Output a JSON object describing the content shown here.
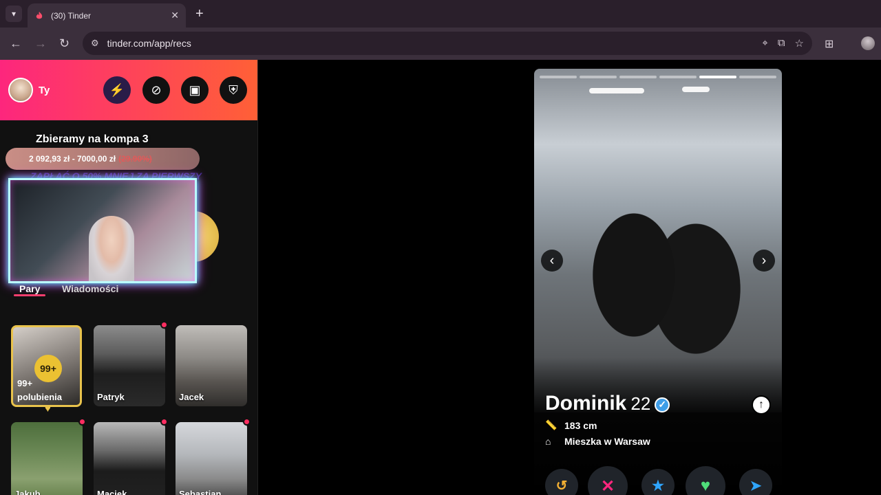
{
  "browser": {
    "tab_title": "(30) Tinder",
    "url": "tinder.com/app/recs",
    "close_glyph": "✕",
    "new_tab_glyph": "+"
  },
  "sidebar": {
    "user_name": "Ty",
    "overlay_title": "Zbieramy na kompa 3",
    "goal_amount": "2 092,93 zł - 7000,00 zł",
    "goal_pct": "(29.90%)",
    "promo_text": "ZAPŁAĆ O 50% MNIEJ ZA PIERWSZY",
    "tabs": [
      "Pary",
      "Wiadomości"
    ],
    "likes": {
      "count": "99+",
      "label_line1": "99+",
      "label_line2": "polubienia"
    },
    "matches": [
      {
        "name": "Patryk"
      },
      {
        "name": "Jacek"
      },
      {
        "name": "Jakub"
      },
      {
        "name": "Maciek"
      },
      {
        "name": "Sebastian"
      }
    ]
  },
  "profile": {
    "name": "Dominik",
    "age": "22",
    "height": "183 cm",
    "location": "Mieszka w Warsaw",
    "photo_count": 6,
    "active_photo": 5
  },
  "colors": {
    "brand_gradient_start": "#fd267d",
    "brand_gradient_end": "#ff6036",
    "rewind": "#f5b133",
    "nope": "#fd267d",
    "superlike": "#2fa6ff",
    "like": "#4fdd7a",
    "boost": "#2fa6ff"
  },
  "icons": {
    "tab_favicon": "tinder-flame-icon",
    "hdr_buttons": [
      "boost-icon",
      "explore-icon",
      "briefcase-icon",
      "shield-icon"
    ],
    "actions": [
      "rewind-icon",
      "nope-icon",
      "superlike-icon",
      "like-icon",
      "boost-icon"
    ]
  }
}
